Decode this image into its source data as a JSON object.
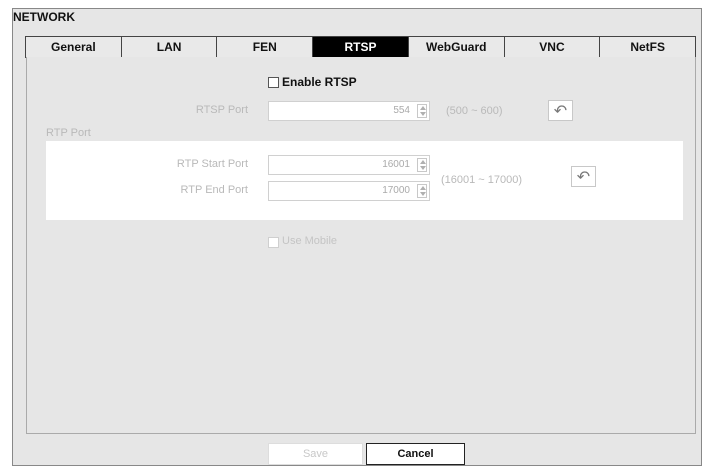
{
  "window": {
    "title": "NETWORK"
  },
  "tabs": [
    {
      "label": "General",
      "active": false
    },
    {
      "label": "LAN",
      "active": false
    },
    {
      "label": "FEN",
      "active": false
    },
    {
      "label": "RTSP",
      "active": true
    },
    {
      "label": "WebGuard",
      "active": false
    },
    {
      "label": "VNC",
      "active": false
    },
    {
      "label": "NetFS",
      "active": false
    }
  ],
  "rtsp": {
    "enable_label": "Enable RTSP",
    "enabled": false,
    "port_label": "RTSP Port",
    "port_value": "554",
    "port_range": "(500 ~ 600)",
    "reset_icon": "undo-arrow-icon"
  },
  "rtp": {
    "section_label": "RTP Port",
    "start_label": "RTP Start Port",
    "start_value": "16001",
    "end_label": "RTP End Port",
    "end_value": "17000",
    "range": "(16001 ~ 17000)",
    "reset_icon": "undo-arrow-icon"
  },
  "mobile": {
    "label": "Use Mobile",
    "checked": false
  },
  "buttons": {
    "save": "Save",
    "cancel": "Cancel"
  },
  "colors": {
    "active_tab_bg": "#000000",
    "panel_bg": "#e6e6e6",
    "disabled_text": "#b9b9b9"
  }
}
